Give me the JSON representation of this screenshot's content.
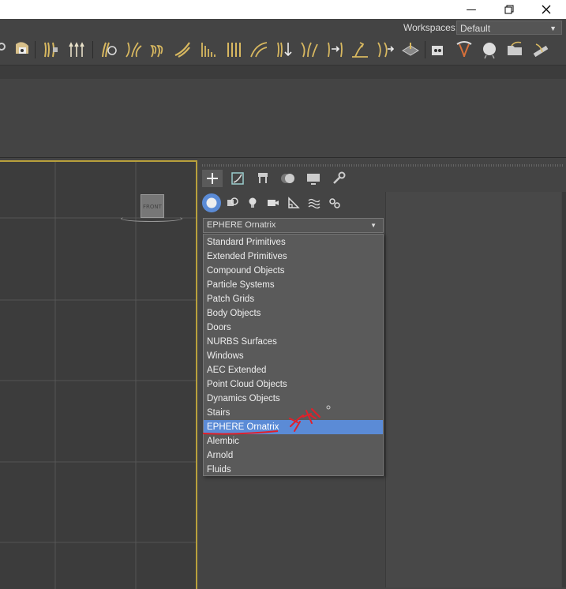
{
  "window": {
    "minimize_icon": "minimize-icon",
    "maximize_icon": "restore-icon",
    "close_icon": "close-icon"
  },
  "workspaces": {
    "label": "Workspaces:",
    "value": "Default"
  },
  "viewport": {
    "viewcube_label": "FRONT"
  },
  "command_panel": {
    "tabs": [
      {
        "name": "create-tab",
        "icon": "plus-icon"
      },
      {
        "name": "modify-tab",
        "icon": "modify-icon"
      },
      {
        "name": "hierarchy-tab",
        "icon": "hierarchy-icon"
      },
      {
        "name": "motion-tab",
        "icon": "motion-icon"
      },
      {
        "name": "display-tab",
        "icon": "display-icon"
      },
      {
        "name": "utilities-tab",
        "icon": "wrench-icon"
      }
    ],
    "subcategories": [
      {
        "name": "geometry",
        "icon": "sphere-icon"
      },
      {
        "name": "shapes",
        "icon": "shapes-icon"
      },
      {
        "name": "lights",
        "icon": "light-bulb-icon"
      },
      {
        "name": "cameras",
        "icon": "camera-icon"
      },
      {
        "name": "helpers",
        "icon": "helper-icon"
      },
      {
        "name": "space-warps",
        "icon": "wave-icon"
      },
      {
        "name": "systems",
        "icon": "gears-icon"
      }
    ],
    "category_select": {
      "value": "EPHERE Ornatrix",
      "options": [
        "Standard Primitives",
        "Extended Primitives",
        "Compound Objects",
        "Particle Systems",
        "Patch Grids",
        "Body Objects",
        "Doors",
        "NURBS Surfaces",
        "Windows",
        "AEC Extended",
        "Point Cloud Objects",
        "Dynamics Objects",
        "Stairs",
        "EPHERE Ornatrix",
        "Alembic",
        "Arnold",
        "Fluids"
      ],
      "selected_index": 13
    }
  },
  "colors": {
    "accent": "#5b8bd6",
    "annotation": "#e0202a",
    "viewport_border": "#b8a03c"
  }
}
